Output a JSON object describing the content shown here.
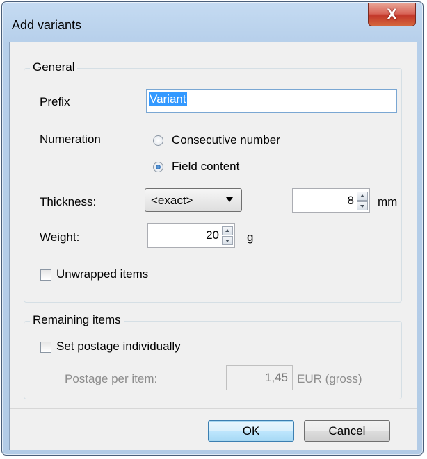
{
  "window": {
    "title": "Add variants",
    "close_glyph": "X"
  },
  "general": {
    "legend": "General",
    "prefix_label": "Prefix",
    "prefix_value": "Variant",
    "numeration_label": "Numeration",
    "numeration_options": [
      {
        "label": "Consecutive number",
        "checked": false
      },
      {
        "label": "Field content",
        "checked": true
      }
    ],
    "thickness_label": "Thickness:",
    "thickness_select": "<exact>",
    "thickness_value": "8",
    "thickness_unit": "mm",
    "weight_label": "Weight:",
    "weight_value": "20",
    "weight_unit": "g",
    "unwrapped_label": "Unwrapped items",
    "unwrapped_checked": false
  },
  "remaining": {
    "legend": "Remaining items",
    "set_postage_label": "Set postage individually",
    "set_postage_checked": false,
    "postage_label": "Postage per item:",
    "postage_value": "1,45",
    "postage_unit": "EUR (gross)"
  },
  "buttons": {
    "ok": "OK",
    "cancel": "Cancel"
  },
  "icons": {
    "close": "close-icon",
    "dropdown": "chevron-down-icon",
    "spin_up": "spin-up-icon",
    "spin_down": "spin-down-icon"
  }
}
